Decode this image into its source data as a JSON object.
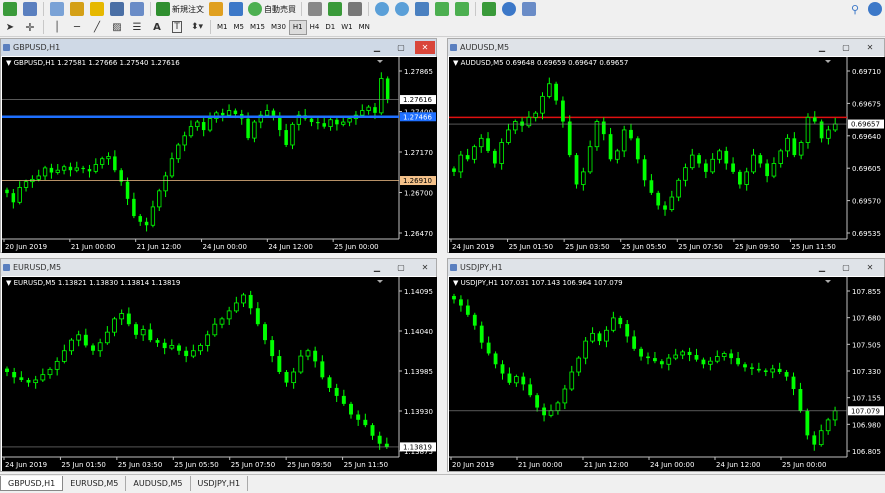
{
  "toolbar": {
    "new_order_label": "新規注文",
    "auto_trading_label": "自動売買",
    "timeframes": [
      "M1",
      "M5",
      "M15",
      "M30",
      "H1",
      "H4",
      "D1",
      "W1",
      "MN"
    ],
    "active_timeframe": "H1"
  },
  "windows": [
    {
      "id": "gbp",
      "title": "GBPUSD,H1",
      "info": "GBPUSD,H1  1.27581 1.27666 1.27540 1.27616",
      "price_labels": [
        "1.27865",
        "1.27400",
        "1.27170",
        "1.26700",
        "1.26470"
      ],
      "tagged_levels": [
        {
          "value": "1.27616",
          "kind": "line"
        },
        {
          "value": "1.27466",
          "kind": "blue"
        },
        {
          "value": "1.26910",
          "kind": "orange"
        }
      ],
      "time_labels": [
        "20 Jun 2019",
        "21 Jun 00:00",
        "21 Jun 12:00",
        "24 Jun 00:00",
        "24 Jun 12:00",
        "25 Jun 00:00"
      ]
    },
    {
      "id": "aud",
      "title": "AUDUSD,M5",
      "info": "AUDUSD,M5  0.69648 0.69659 0.69647 0.69657",
      "price_labels": [
        "0.69710",
        "0.69675",
        "0.69640",
        "0.69605",
        "0.69570",
        "0.69535"
      ],
      "tagged_levels": [
        {
          "value": "0.69657",
          "kind": "line"
        }
      ],
      "time_labels": [
        "24 Jun 2019",
        "25 Jun 01:50",
        "25 Jun 03:50",
        "25 Jun 05:50",
        "25 Jun 07:50",
        "25 Jun 09:50",
        "25 Jun 11:50"
      ]
    },
    {
      "id": "eur",
      "title": "EURUSD,M5",
      "info": "EURUSD,M5  1.13821 1.13830 1.13814 1.13819",
      "price_labels": [
        "1.14095",
        "1.14040",
        "1.13985",
        "1.13930",
        "1.13875"
      ],
      "tagged_levels": [
        {
          "value": "1.13819",
          "kind": "line"
        }
      ],
      "time_labels": [
        "24 Jun 2019",
        "25 Jun 01:50",
        "25 Jun 03:50",
        "25 Jun 05:50",
        "25 Jun 07:50",
        "25 Jun 09:50",
        "25 Jun 11:50"
      ]
    },
    {
      "id": "jpy",
      "title": "USDJPY,H1",
      "info": "USDJPY,H1  107.031 107.143 106.964 107.079",
      "price_labels": [
        "107.855",
        "107.680",
        "107.505",
        "107.330",
        "107.155",
        "106.980",
        "106.805"
      ],
      "tagged_levels": [
        {
          "value": "107.079",
          "kind": "line"
        }
      ],
      "time_labels": [
        "20 Jun 2019",
        "21 Jun 00:00",
        "21 Jun 12:00",
        "24 Jun 00:00",
        "24 Jun 12:00",
        "25 Jun 00:00"
      ]
    }
  ],
  "tabs": [
    "GBPUSD,H1",
    "EURUSD,M5",
    "AUDUSD,M5",
    "USDJPY,H1"
  ],
  "active_tab": "GBPUSD,H1",
  "colors": {
    "chart_bg": "#000000",
    "candle": "#00ff00",
    "blue_line": "#1e6fff",
    "red_line": "#e01010",
    "orange_tag": "#f5c28a",
    "close_red": "#d9463a"
  },
  "chart_data": [
    {
      "type": "candlestick",
      "title": "GBPUSD,H1",
      "ylim": [
        1.264,
        1.279
      ],
      "close_series": [
        1.268,
        1.2672,
        1.2685,
        1.269,
        1.2692,
        1.2695,
        1.2702,
        1.2698,
        1.27,
        1.2703,
        1.27,
        1.2702,
        1.2701,
        1.2699,
        1.2705,
        1.271,
        1.2712,
        1.27,
        1.269,
        1.2675,
        1.266,
        1.2655,
        1.2652,
        1.2668,
        1.2682,
        1.2695,
        1.271,
        1.2722,
        1.273,
        1.2738,
        1.2742,
        1.2735,
        1.2745,
        1.275,
        1.2748,
        1.2752,
        1.2749,
        1.2745,
        1.2728,
        1.2742,
        1.2748,
        1.2752,
        1.2747,
        1.2735,
        1.2722,
        1.274,
        1.2748,
        1.2745,
        1.2742,
        1.2741,
        1.2738,
        1.2744,
        1.274,
        1.2742,
        1.2745,
        1.2748,
        1.2752,
        1.2755,
        1.275,
        1.278,
        1.2762
      ]
    },
    {
      "type": "candlestick",
      "title": "AUDUSD,M5",
      "ylim": [
        0.6952,
        0.69725
      ],
      "close_series": [
        0.696,
        0.6962,
        0.69615,
        0.6963,
        0.6964,
        0.69625,
        0.6961,
        0.69635,
        0.6965,
        0.6966,
        0.69655,
        0.69665,
        0.6967,
        0.6969,
        0.69705,
        0.69685,
        0.6966,
        0.6962,
        0.69585,
        0.696,
        0.6963,
        0.6966,
        0.69645,
        0.69615,
        0.69625,
        0.6965,
        0.6964,
        0.69615,
        0.6959,
        0.69575,
        0.6956,
        0.69555,
        0.6957,
        0.6959,
        0.69605,
        0.6962,
        0.6961,
        0.696,
        0.69615,
        0.69625,
        0.6961,
        0.696,
        0.69585,
        0.696,
        0.6962,
        0.6961,
        0.69595,
        0.6961,
        0.69625,
        0.6964,
        0.6962,
        0.69635,
        0.69665,
        0.6966,
        0.6964,
        0.6965,
        0.69657
      ]
    },
    {
      "type": "candlestick",
      "title": "EURUSD,M5",
      "ylim": [
        1.138,
        1.1412
      ],
      "close_series": [
        1.1396,
        1.1395,
        1.13945,
        1.1394,
        1.13945,
        1.13955,
        1.13965,
        1.1398,
        1.14,
        1.1402,
        1.1403,
        1.1401,
        1.14,
        1.14015,
        1.14035,
        1.1406,
        1.1407,
        1.1405,
        1.1403,
        1.1404,
        1.1402,
        1.14015,
        1.14005,
        1.1401,
        1.14,
        1.1399,
        1.14,
        1.1401,
        1.1403,
        1.1405,
        1.1406,
        1.14075,
        1.1409,
        1.14105,
        1.1408,
        1.1405,
        1.1402,
        1.1399,
        1.1396,
        1.1394,
        1.1396,
        1.1399,
        1.14,
        1.1398,
        1.1395,
        1.1393,
        1.13915,
        1.139,
        1.1388,
        1.1387,
        1.1386,
        1.1384,
        1.13825,
        1.13819
      ]
    },
    {
      "type": "candlestick",
      "title": "USDJPY,H1",
      "ylim": [
        106.78,
        107.88
      ],
      "close_series": [
        107.8,
        107.76,
        107.7,
        107.63,
        107.52,
        107.45,
        107.38,
        107.32,
        107.26,
        107.3,
        107.25,
        107.18,
        107.1,
        107.05,
        107.08,
        107.13,
        107.22,
        107.33,
        107.42,
        107.53,
        107.58,
        107.53,
        107.6,
        107.68,
        107.64,
        107.56,
        107.48,
        107.43,
        107.42,
        107.4,
        107.38,
        107.42,
        107.44,
        107.46,
        107.44,
        107.41,
        107.38,
        107.4,
        107.43,
        107.45,
        107.42,
        107.38,
        107.36,
        107.35,
        107.34,
        107.33,
        107.35,
        107.33,
        107.3,
        107.22,
        107.08,
        106.92,
        106.86,
        106.95,
        107.02,
        107.079
      ]
    }
  ]
}
